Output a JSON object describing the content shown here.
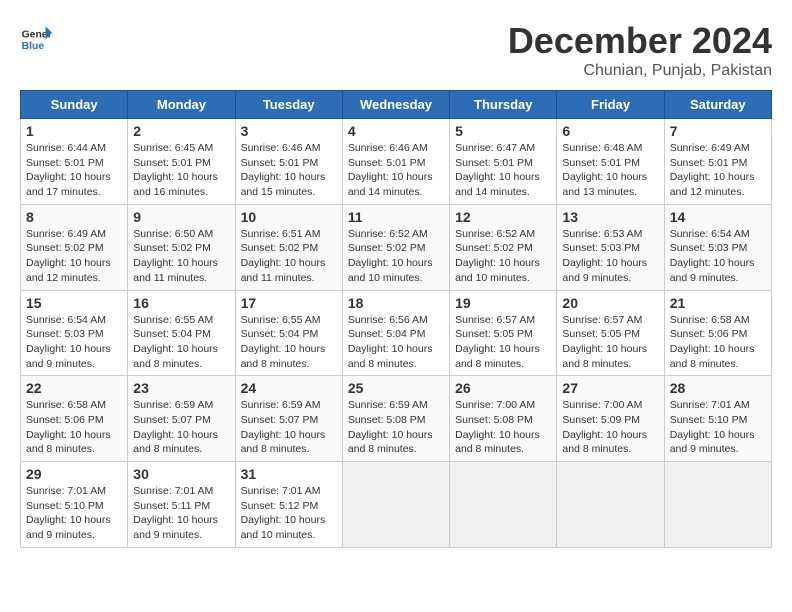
{
  "header": {
    "logo_line1": "General",
    "logo_line2": "Blue",
    "month": "December 2024",
    "location": "Chunian, Punjab, Pakistan"
  },
  "days_of_week": [
    "Sunday",
    "Monday",
    "Tuesday",
    "Wednesday",
    "Thursday",
    "Friday",
    "Saturday"
  ],
  "weeks": [
    [
      {
        "day": "1",
        "sunrise": "6:44 AM",
        "sunset": "5:01 PM",
        "daylight": "10 hours and 17 minutes."
      },
      {
        "day": "2",
        "sunrise": "6:45 AM",
        "sunset": "5:01 PM",
        "daylight": "10 hours and 16 minutes."
      },
      {
        "day": "3",
        "sunrise": "6:46 AM",
        "sunset": "5:01 PM",
        "daylight": "10 hours and 15 minutes."
      },
      {
        "day": "4",
        "sunrise": "6:46 AM",
        "sunset": "5:01 PM",
        "daylight": "10 hours and 14 minutes."
      },
      {
        "day": "5",
        "sunrise": "6:47 AM",
        "sunset": "5:01 PM",
        "daylight": "10 hours and 14 minutes."
      },
      {
        "day": "6",
        "sunrise": "6:48 AM",
        "sunset": "5:01 PM",
        "daylight": "10 hours and 13 minutes."
      },
      {
        "day": "7",
        "sunrise": "6:49 AM",
        "sunset": "5:01 PM",
        "daylight": "10 hours and 12 minutes."
      }
    ],
    [
      {
        "day": "8",
        "sunrise": "6:49 AM",
        "sunset": "5:02 PM",
        "daylight": "10 hours and 12 minutes."
      },
      {
        "day": "9",
        "sunrise": "6:50 AM",
        "sunset": "5:02 PM",
        "daylight": "10 hours and 11 minutes."
      },
      {
        "day": "10",
        "sunrise": "6:51 AM",
        "sunset": "5:02 PM",
        "daylight": "10 hours and 11 minutes."
      },
      {
        "day": "11",
        "sunrise": "6:52 AM",
        "sunset": "5:02 PM",
        "daylight": "10 hours and 10 minutes."
      },
      {
        "day": "12",
        "sunrise": "6:52 AM",
        "sunset": "5:02 PM",
        "daylight": "10 hours and 10 minutes."
      },
      {
        "day": "13",
        "sunrise": "6:53 AM",
        "sunset": "5:03 PM",
        "daylight": "10 hours and 9 minutes."
      },
      {
        "day": "14",
        "sunrise": "6:54 AM",
        "sunset": "5:03 PM",
        "daylight": "10 hours and 9 minutes."
      }
    ],
    [
      {
        "day": "15",
        "sunrise": "6:54 AM",
        "sunset": "5:03 PM",
        "daylight": "10 hours and 9 minutes."
      },
      {
        "day": "16",
        "sunrise": "6:55 AM",
        "sunset": "5:04 PM",
        "daylight": "10 hours and 8 minutes."
      },
      {
        "day": "17",
        "sunrise": "6:55 AM",
        "sunset": "5:04 PM",
        "daylight": "10 hours and 8 minutes."
      },
      {
        "day": "18",
        "sunrise": "6:56 AM",
        "sunset": "5:04 PM",
        "daylight": "10 hours and 8 minutes."
      },
      {
        "day": "19",
        "sunrise": "6:57 AM",
        "sunset": "5:05 PM",
        "daylight": "10 hours and 8 minutes."
      },
      {
        "day": "20",
        "sunrise": "6:57 AM",
        "sunset": "5:05 PM",
        "daylight": "10 hours and 8 minutes."
      },
      {
        "day": "21",
        "sunrise": "6:58 AM",
        "sunset": "5:06 PM",
        "daylight": "10 hours and 8 minutes."
      }
    ],
    [
      {
        "day": "22",
        "sunrise": "6:58 AM",
        "sunset": "5:06 PM",
        "daylight": "10 hours and 8 minutes."
      },
      {
        "day": "23",
        "sunrise": "6:59 AM",
        "sunset": "5:07 PM",
        "daylight": "10 hours and 8 minutes."
      },
      {
        "day": "24",
        "sunrise": "6:59 AM",
        "sunset": "5:07 PM",
        "daylight": "10 hours and 8 minutes."
      },
      {
        "day": "25",
        "sunrise": "6:59 AM",
        "sunset": "5:08 PM",
        "daylight": "10 hours and 8 minutes."
      },
      {
        "day": "26",
        "sunrise": "7:00 AM",
        "sunset": "5:08 PM",
        "daylight": "10 hours and 8 minutes."
      },
      {
        "day": "27",
        "sunrise": "7:00 AM",
        "sunset": "5:09 PM",
        "daylight": "10 hours and 8 minutes."
      },
      {
        "day": "28",
        "sunrise": "7:01 AM",
        "sunset": "5:10 PM",
        "daylight": "10 hours and 9 minutes."
      }
    ],
    [
      {
        "day": "29",
        "sunrise": "7:01 AM",
        "sunset": "5:10 PM",
        "daylight": "10 hours and 9 minutes."
      },
      {
        "day": "30",
        "sunrise": "7:01 AM",
        "sunset": "5:11 PM",
        "daylight": "10 hours and 9 minutes."
      },
      {
        "day": "31",
        "sunrise": "7:01 AM",
        "sunset": "5:12 PM",
        "daylight": "10 hours and 10 minutes."
      },
      null,
      null,
      null,
      null
    ]
  ]
}
